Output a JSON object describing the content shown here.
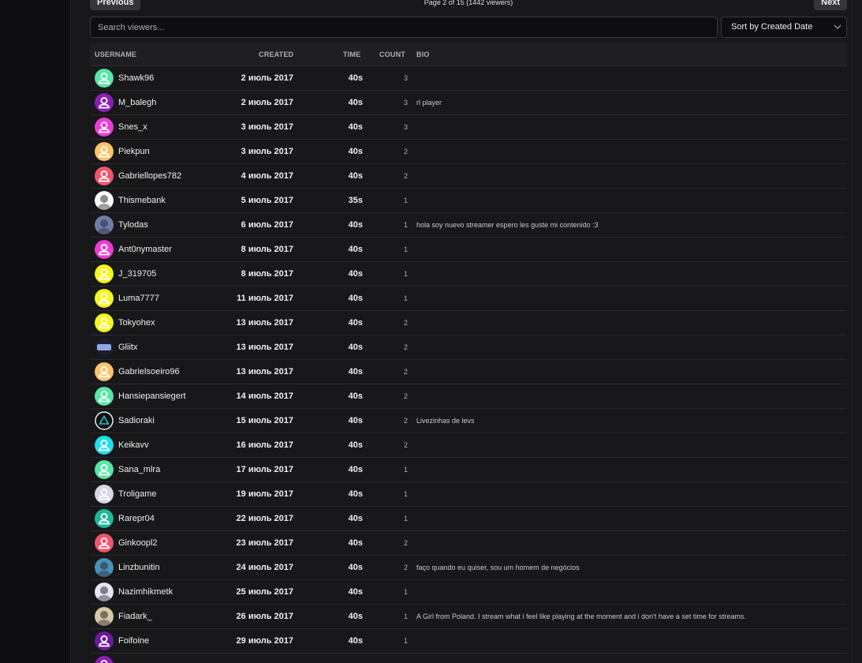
{
  "pager": {
    "prev_label": "Previous",
    "next_label": "Next",
    "info": "Page 2 of 15 (1442 viewers)"
  },
  "search": {
    "placeholder": "Search viewers..."
  },
  "sort": {
    "selected": "Sort by Created Date"
  },
  "columns": {
    "username": "USERNAME",
    "created": "CREATED",
    "time": "TIME",
    "count": "COUNT",
    "bio": "BIO"
  },
  "rows": [
    {
      "username": "Shawk96",
      "created": "2 июль 2017",
      "time": "40s",
      "count": "3",
      "bio": "",
      "avatar": "default-user-icon",
      "color": "#58e6a7"
    },
    {
      "username": "M_balegh",
      "created": "2 июль 2017",
      "time": "40s",
      "count": "3",
      "bio": "rl player",
      "avatar": "default-user-icon",
      "color": "#8a1fb8"
    },
    {
      "username": "Snes_x",
      "created": "3 июль 2017",
      "time": "40s",
      "count": "3",
      "bio": "",
      "avatar": "default-user-icon",
      "color": "#ef3bd4"
    },
    {
      "username": "Piekpun",
      "created": "3 июль 2017",
      "time": "40s",
      "count": "2",
      "bio": "",
      "avatar": "default-user-icon",
      "color": "#ffc36b"
    },
    {
      "username": "Gabriellopes782",
      "created": "4 июль 2017",
      "time": "40s",
      "count": "2",
      "bio": "",
      "avatar": "default-user-icon",
      "color": "#f2546b"
    },
    {
      "username": "Thismebank",
      "created": "5 июль 2017",
      "time": "35s",
      "count": "1",
      "bio": "",
      "avatar": "photo-avatar-icon",
      "color": "#ffffff"
    },
    {
      "username": "Tylodas",
      "created": "6 июль 2017",
      "time": "40s",
      "count": "1",
      "bio": "hola soy nuevo streamer espero les guste mi contenido :3",
      "avatar": "photo-avatar-icon",
      "color": "#6f7ea8"
    },
    {
      "username": "Ant0nymaster",
      "created": "8 июль 2017",
      "time": "40s",
      "count": "1",
      "bio": "",
      "avatar": "default-user-icon",
      "color": "#ef3bd4"
    },
    {
      "username": "J_319705",
      "created": "8 июль 2017",
      "time": "40s",
      "count": "1",
      "bio": "",
      "avatar": "default-user-icon",
      "color": "#f5f51e"
    },
    {
      "username": "Luma7777",
      "created": "11 июль 2017",
      "time": "40s",
      "count": "1",
      "bio": "",
      "avatar": "default-user-icon",
      "color": "#f5f51e"
    },
    {
      "username": "Tokyohex",
      "created": "13 июль 2017",
      "time": "40s",
      "count": "2",
      "bio": "",
      "avatar": "default-user-icon",
      "color": "#f5f51e"
    },
    {
      "username": "Gliitx",
      "created": "13 июль 2017",
      "time": "40s",
      "count": "2",
      "bio": "",
      "avatar": "logo-avatar-icon",
      "color": "#3b4a7a"
    },
    {
      "username": "Gabrielsoeiro96",
      "created": "13 июль 2017",
      "time": "40s",
      "count": "2",
      "bio": "",
      "avatar": "default-user-icon",
      "color": "#ffc36b"
    },
    {
      "username": "Hansiepansiegert",
      "created": "14 июль 2017",
      "time": "40s",
      "count": "2",
      "bio": "",
      "avatar": "default-user-icon",
      "color": "#58e6a7"
    },
    {
      "username": "Sadioraki",
      "created": "15 июль 2017",
      "time": "40s",
      "count": "2",
      "bio": "Livezinhas de levs",
      "avatar": "triangle-avatar-icon",
      "color": "#0e0e10"
    },
    {
      "username": "Keikavv",
      "created": "16 июль 2017",
      "time": "40s",
      "count": "2",
      "bio": "",
      "avatar": "default-user-icon",
      "color": "#1fe0e6"
    },
    {
      "username": "Sana_mlra",
      "created": "17 июль 2017",
      "time": "40s",
      "count": "1",
      "bio": "",
      "avatar": "default-user-icon",
      "color": "#58e6a7"
    },
    {
      "username": "Troligame",
      "created": "19 июль 2017",
      "time": "40s",
      "count": "1",
      "bio": "",
      "avatar": "default-user-icon",
      "color": "#d6d6e6"
    },
    {
      "username": "Rarepr04",
      "created": "22 июль 2017",
      "time": "40s",
      "count": "1",
      "bio": "",
      "avatar": "default-user-icon",
      "color": "#1fb89a"
    },
    {
      "username": "Ginkoopl2",
      "created": "23 июль 2017",
      "time": "40s",
      "count": "2",
      "bio": "",
      "avatar": "default-user-icon",
      "color": "#f2546b"
    },
    {
      "username": "Linzbunitin",
      "created": "24 июль 2017",
      "time": "40s",
      "count": "2",
      "bio": "faço quando eu quiser, sou um homem de negócios",
      "avatar": "photo-avatar-icon",
      "color": "#4a8fb8"
    },
    {
      "username": "Nazimhikmetk",
      "created": "25 июль 2017",
      "time": "40s",
      "count": "1",
      "bio": "",
      "avatar": "photo-avatar-icon",
      "color": "#e8e4f0"
    },
    {
      "username": "Fiadark_",
      "created": "26 июль 2017",
      "time": "40s",
      "count": "1",
      "bio": "A Girl from Poland. I stream what i feel like playing at the moment and i don't have a set time for streams.",
      "avatar": "photo-avatar-icon",
      "color": "#d8c8a8"
    },
    {
      "username": "Foifoine",
      "created": "29 июль 2017",
      "time": "40s",
      "count": "1",
      "bio": "",
      "avatar": "default-user-icon",
      "color": "#6a1a9a"
    },
    {
      "username": "",
      "created": "",
      "time": "",
      "count": "",
      "bio": "",
      "avatar": "default-user-icon",
      "color": "#8a1fb8"
    }
  ]
}
